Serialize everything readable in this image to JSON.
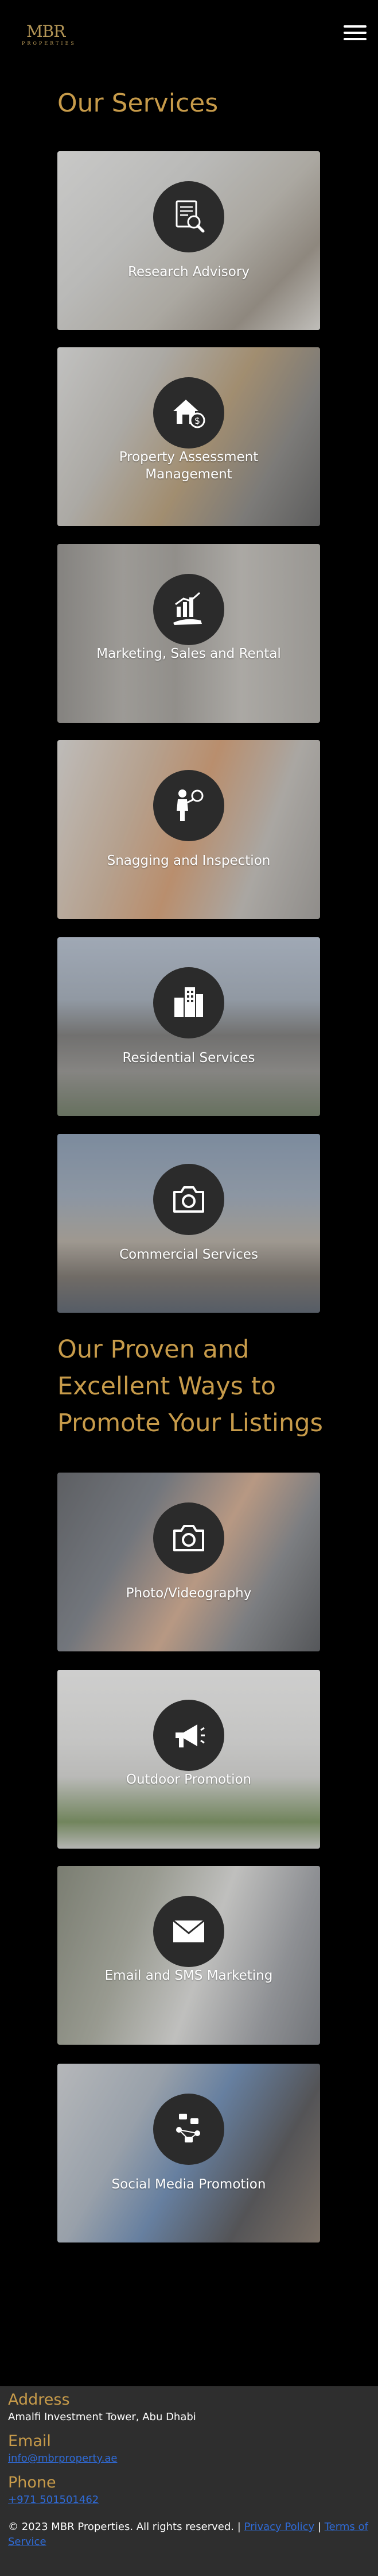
{
  "header": {
    "logo_text": "MBR",
    "logo_sub": "PROPERTIES",
    "menu_icon": "hamburger-menu-icon"
  },
  "services": {
    "title": "Our Services",
    "items": [
      {
        "label": "Research Advisory",
        "icon": "document-magnifier-icon"
      },
      {
        "label": "Property Assessment Management",
        "icon": "house-money-icon"
      },
      {
        "label": "Marketing, Sales and Rental",
        "icon": "growth-chart-hand-icon"
      },
      {
        "label": "Snagging and Inspection",
        "icon": "inspector-magnifier-icon"
      },
      {
        "label": "Residential Services",
        "icon": "buildings-icon"
      },
      {
        "label": "Commercial Services",
        "icon": "camera-icon"
      }
    ]
  },
  "promote": {
    "title": "Our Proven and Excellent Ways to Promote Your Listings",
    "items": [
      {
        "label": "Photo/Videography",
        "icon": "camera-icon"
      },
      {
        "label": "Outdoor Promotion",
        "icon": "megaphone-icon"
      },
      {
        "label": "Email and SMS Marketing",
        "icon": "envelope-icon"
      },
      {
        "label": "Social Media Promotion",
        "icon": "social-network-icon"
      }
    ]
  },
  "footer": {
    "address_label": "Address",
    "address_value": "Amalfi Investment Tower, Abu Dhabi",
    "email_label": "Email",
    "email_value": "info@mbrproperty.ae",
    "phone_label": "Phone",
    "phone_value": "+971 501501462",
    "copyright": "© 2023 MBR Properties. All rights reserved. |",
    "privacy_link": "Privacy Policy",
    "separator": "|",
    "terms_link": "Terms of Service"
  },
  "colors": {
    "accent": "#c79b4a",
    "background": "#000000",
    "footer_bg": "#2e2e2e",
    "link": "#2f6bd8"
  }
}
